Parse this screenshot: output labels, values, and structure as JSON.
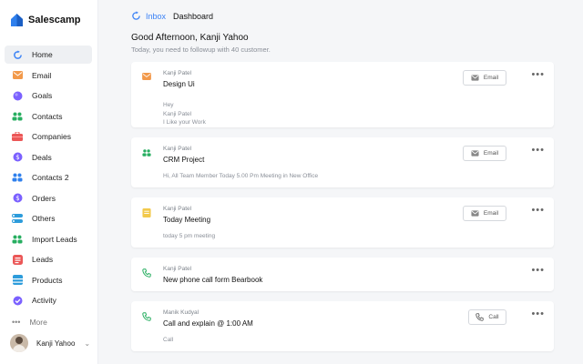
{
  "app": {
    "name": "Salescamp"
  },
  "colors": {
    "accent": "#3b82f6",
    "brand_blue": "#2f80ed",
    "brand_green": "#27ae60"
  },
  "sidebar": {
    "items": [
      {
        "label": "Home",
        "icon": "home-icon",
        "active": true
      },
      {
        "label": "Email",
        "icon": "email-icon"
      },
      {
        "label": "Goals",
        "icon": "goals-icon"
      },
      {
        "label": "Contacts",
        "icon": "contacts-icon"
      },
      {
        "label": "Companies",
        "icon": "companies-icon"
      },
      {
        "label": "Deals",
        "icon": "deals-icon"
      },
      {
        "label": "Contacts 2",
        "icon": "contacts-2-icon"
      },
      {
        "label": "Orders",
        "icon": "orders-icon"
      },
      {
        "label": "Others",
        "icon": "others-icon"
      },
      {
        "label": "Import Leads",
        "icon": "import-leads-icon"
      },
      {
        "label": "Leads",
        "icon": "leads-icon"
      },
      {
        "label": "Products",
        "icon": "products-icon"
      },
      {
        "label": "Activity",
        "icon": "activity-icon"
      }
    ],
    "more_label": "More",
    "user": {
      "name": "Kanji Yahoo"
    }
  },
  "header": {
    "breadcrumb_inbox": "Inbox",
    "breadcrumb_current": "Dashboard"
  },
  "greeting": {
    "title": "Good Afternoon, Kanji Yahoo",
    "subtitle": "Today, you need to followup with 40 customer."
  },
  "feed": [
    {
      "type": "email",
      "author": "Kanji Patel",
      "title": "Design Ui",
      "text": "Hey\nKanji Patel\nI Like your Work",
      "action": "Email"
    },
    {
      "type": "contact",
      "author": "Kanji Patel",
      "title": "CRM Project",
      "text": "Hi, All Team Member Today 5.00 Pm Meeting in New Office",
      "action": "Email"
    },
    {
      "type": "note",
      "author": "Kanji Patel",
      "title": "Today Meeting",
      "text": "today 5 pm meeting",
      "action": "Email"
    },
    {
      "type": "phone",
      "author": "Kanji Patel",
      "title": "New phone call form Bearbook",
      "text": "",
      "action": ""
    },
    {
      "type": "phone",
      "author": "Manik Kudyal",
      "title": "Call and explain @ 1:00 AM",
      "text": "Call",
      "action": "Call"
    }
  ]
}
